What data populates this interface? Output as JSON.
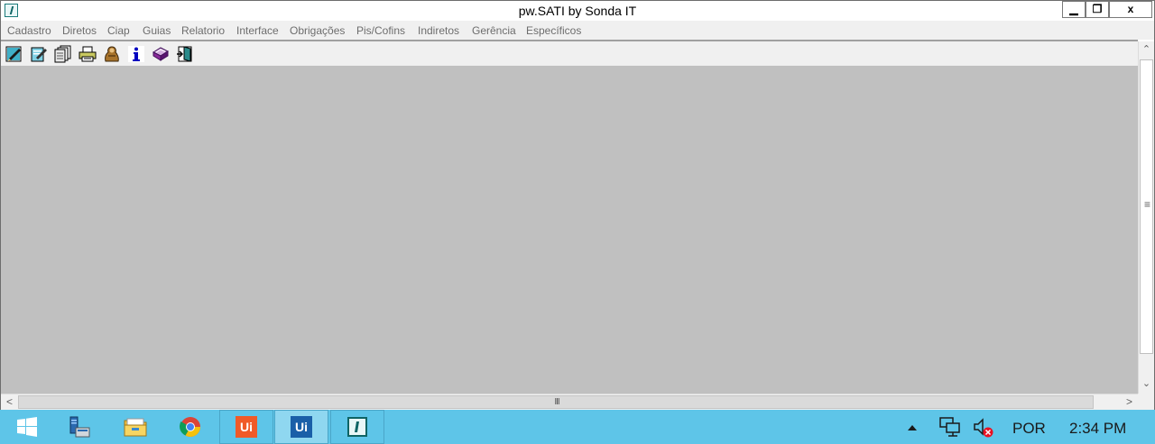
{
  "window": {
    "title": "pw.SATI by Sonda IT",
    "controls": {
      "minimize": "▁",
      "restore": "❐",
      "close": "x"
    }
  },
  "menu": {
    "items": [
      "Cadastro",
      "Diretos",
      "Ciap",
      "Guias",
      "Relatorio",
      "Interface",
      "Obrigações",
      "Pis/Cofins",
      "Indiretos",
      "Gerência",
      "Específicos"
    ]
  },
  "toolbar": {
    "icons": [
      "edit-icon",
      "edit-doc-icon",
      "copy-pages-icon",
      "printer-icon",
      "figure-icon",
      "info-icon",
      "book-icon",
      "exit-door-icon"
    ]
  },
  "scrollbars": {
    "up": "⌃",
    "down": "⌄",
    "left": "<",
    "right": ">",
    "v_grip": "≡",
    "h_grip": "III"
  },
  "taskbar": {
    "apps": [
      "windows-start-icon",
      "server-manager-icon",
      "file-explorer-icon",
      "chrome-icon",
      "uipath-studio-icon",
      "uipath-robot-icon",
      "pwsati-icon"
    ],
    "tray": {
      "language": "POR",
      "time": "2:34 PM"
    }
  },
  "colors": {
    "client_bg": "#c0c0c0",
    "taskbar_bg": "#5ec5e8",
    "uipath_orange": "#f05a28",
    "uipath_blue": "#1a5fa8"
  }
}
